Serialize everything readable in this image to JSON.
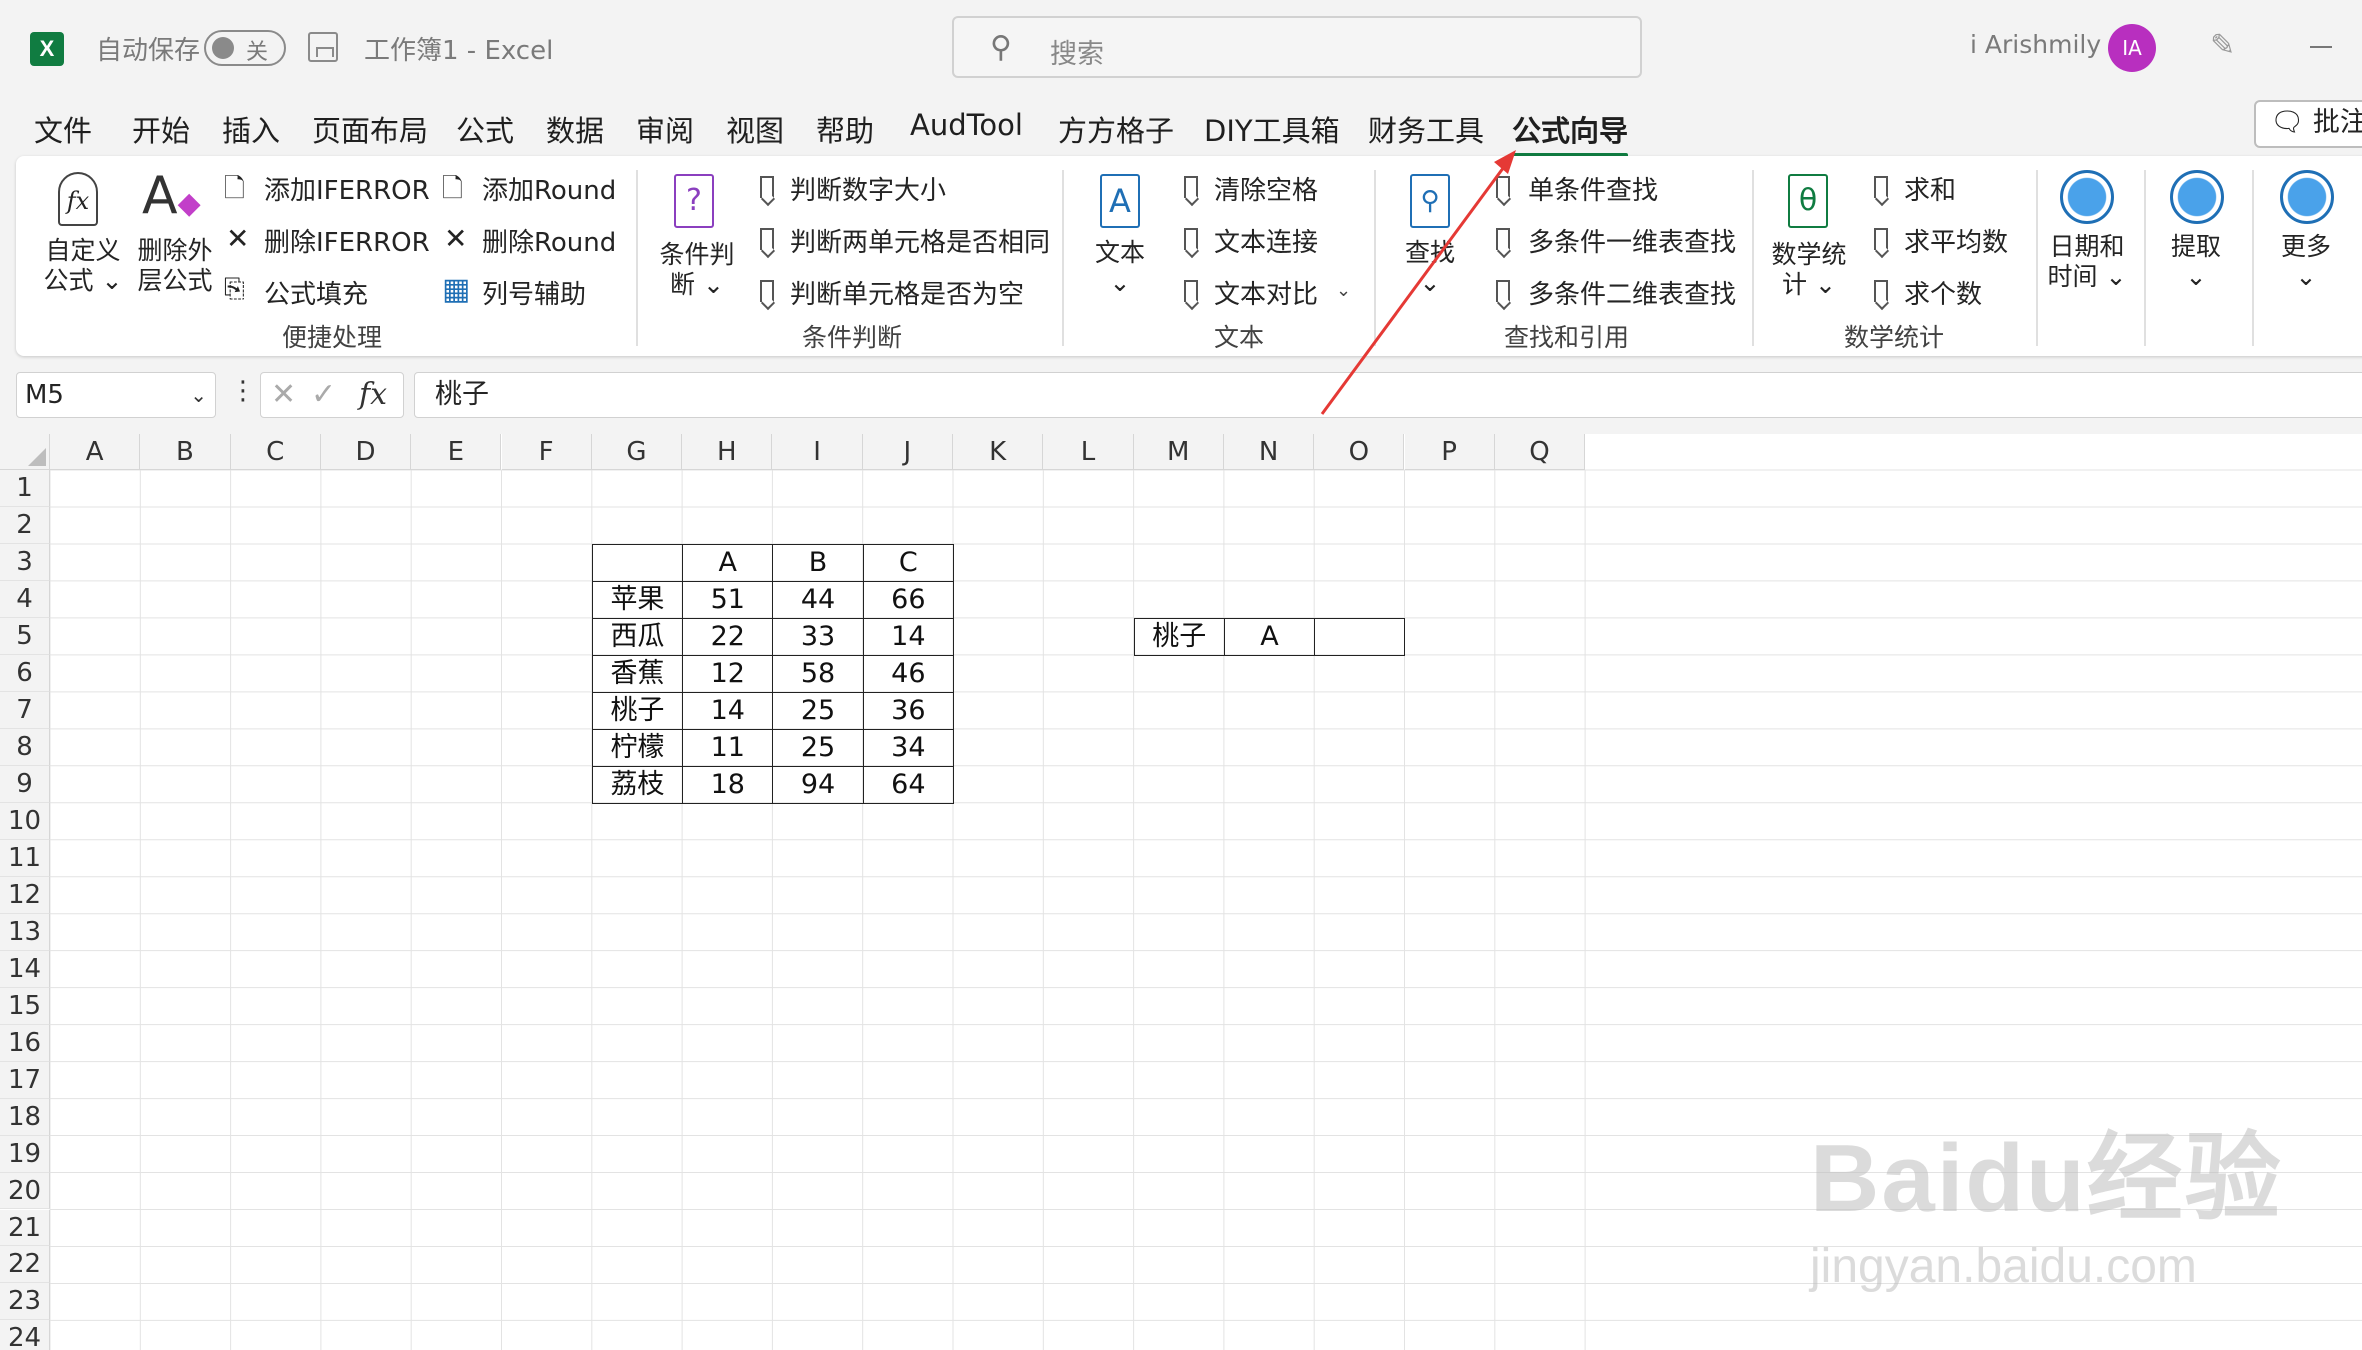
{
  "titlebar": {
    "autosave_label": "自动保存",
    "autosave_state": "关",
    "document_title": "工作簿1  -  Excel",
    "search_placeholder": "搜索",
    "user_name": "i Arishmily",
    "avatar_initials": "IA"
  },
  "menu": {
    "tabs": [
      "文件",
      "开始",
      "插入",
      "页面布局",
      "公式",
      "数据",
      "审阅",
      "视图",
      "帮助",
      "AudTool",
      "方方格子",
      "DIY工具箱",
      "财务工具",
      "公式向导"
    ],
    "active_tab": "公式向导",
    "comment_button": "批注"
  },
  "ribbon": {
    "group1": {
      "label": "便捷处理",
      "custom_formula": "自定义\n公式 ⌄",
      "remove_outer": "删除外\n层公式",
      "add_iferror": "添加IFERROR",
      "remove_iferror": "删除IFERROR",
      "formula_fill": "公式填充",
      "add_round": "添加Round",
      "remove_round": "删除Round",
      "column_helper": "列号辅助"
    },
    "group2": {
      "label": "条件判断",
      "condition": "条件判\n断 ⌄",
      "compare_numbers": "判断数字大小",
      "compare_cells": "判断两单元格是否相同",
      "check_empty": "判断单元格是否为空"
    },
    "group3": {
      "label": "文本",
      "text": "文本\n⌄",
      "trim_spaces": "清除空格",
      "text_join": "文本连接",
      "text_compare": "文本对比"
    },
    "group4": {
      "label": "查找和引用",
      "lookup": "查找\n⌄",
      "single_lookup": "单条件查找",
      "multi_1d": "多条件一维表查找",
      "multi_2d": "多条件二维表查找"
    },
    "group5": {
      "label": "数学统计",
      "math": "数学统\n计 ⌄",
      "sum": "求和",
      "average": "求平均数",
      "count": "求个数"
    },
    "group6": {
      "datetime": "日期和\n时间 ⌄",
      "extract": "提取\n⌄",
      "more": "更多\n⌄"
    }
  },
  "formula_bar": {
    "name_box": "M5",
    "fx": "fx",
    "content": "桃子"
  },
  "sheet": {
    "columns": [
      "A",
      "B",
      "C",
      "D",
      "E",
      "F",
      "G",
      "H",
      "I",
      "J",
      "K",
      "L",
      "M",
      "N",
      "O",
      "P",
      "Q"
    ],
    "rows": [
      "1",
      "2",
      "3",
      "4",
      "5",
      "6",
      "7",
      "8",
      "9",
      "10",
      "11",
      "12",
      "13",
      "14",
      "15",
      "16",
      "17",
      "18",
      "19",
      "20",
      "21",
      "22",
      "23",
      "24"
    ],
    "data_table": {
      "header": [
        "",
        "A",
        "B",
        "C"
      ],
      "rows": [
        [
          "苹果",
          "51",
          "44",
          "66"
        ],
        [
          "西瓜",
          "22",
          "33",
          "14"
        ],
        [
          "香蕉",
          "12",
          "58",
          "46"
        ],
        [
          "桃子",
          "14",
          "25",
          "36"
        ],
        [
          "柠檬",
          "11",
          "25",
          "34"
        ],
        [
          "荔枝",
          "18",
          "94",
          "64"
        ]
      ]
    },
    "lookup_cells": [
      "桃子",
      "A",
      ""
    ]
  },
  "watermark": {
    "logo": "Baidu经验",
    "url": "jingyan.baidu.com"
  },
  "colors": {
    "accent": "#107c41",
    "arrow": "#e53935",
    "avatar": "#b82fbf"
  }
}
